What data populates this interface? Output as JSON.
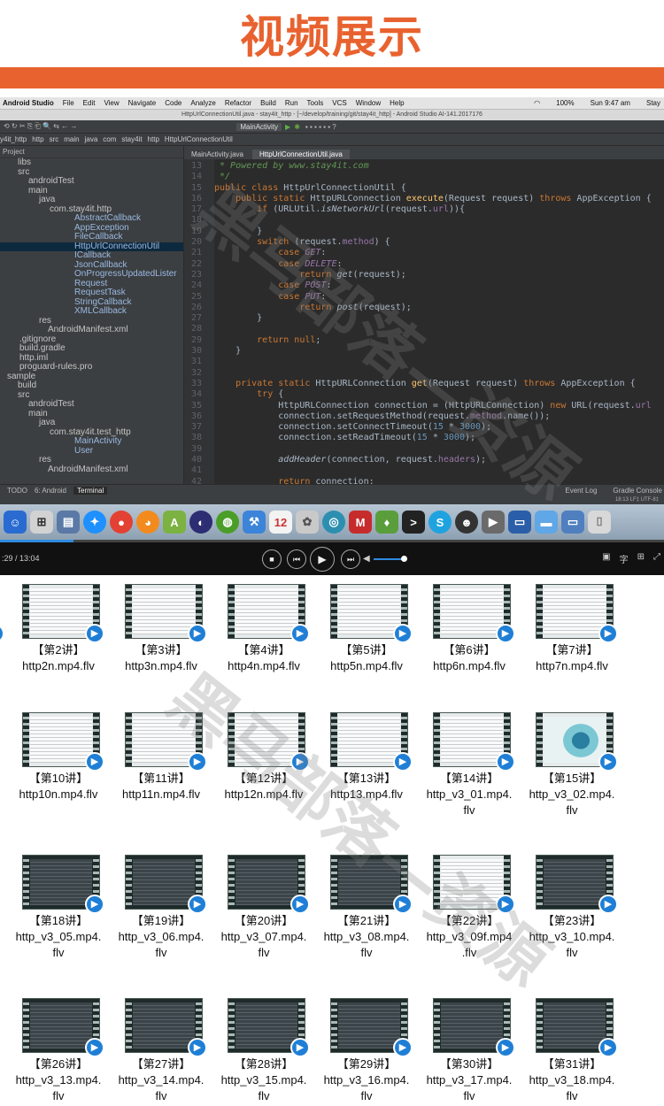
{
  "banner": {
    "title": "视频展示"
  },
  "menubar": {
    "app": "Android Studio",
    "items": [
      "File",
      "Edit",
      "View",
      "Navigate",
      "Code",
      "Analyze",
      "Refactor",
      "Build",
      "Run",
      "Tools",
      "VCS",
      "Window",
      "Help"
    ],
    "battery": "100%",
    "clock": "Sun 9:47 am",
    "user": "Stay"
  },
  "window": {
    "title": "HttpUrlConnectionUtil.java - stay4it_http - [~/develop/training/git/stay4it_http] - Android Studio AI-141.2017176"
  },
  "toolbar": {
    "run_config": "MainActivity"
  },
  "breadcrumbs": [
    "y4it_http",
    "http",
    "src",
    "main",
    "java",
    "com",
    "stay4it",
    "http",
    "HttpUrlConnectionUtil"
  ],
  "project": {
    "header": "Project",
    "tree": [
      "libs",
      "src",
      "androidTest",
      "main",
      "java",
      "com.stay4it.http",
      "AbstractCallback",
      "AppException",
      "FileCallback",
      "HttpUrlConnectionUtil",
      "ICallback",
      "JsonCallback",
      "OnProgressUpdatedLister",
      "Request",
      "RequestTask",
      "StringCallback",
      "XMLCallback",
      "res",
      "AndroidManifest.xml",
      ".gitignore",
      "build.gradle",
      "http.iml",
      "proguard-rules.pro",
      "sample",
      "build",
      "src",
      "androidTest",
      "main",
      "java",
      "com.stay4it.test_http",
      "MainActivity",
      "User",
      "res",
      "AndroidManifest.xml"
    ]
  },
  "editor": {
    "tabs": [
      "MainActivity.java",
      "HttpUrlConnectionUtil.java"
    ],
    "line_numbers": [
      "13",
      "14",
      "15",
      "16",
      "17",
      "18",
      "19",
      "20",
      "21",
      "22",
      "23",
      "24",
      "25",
      "26",
      "27",
      "28",
      "29",
      "30",
      "31",
      "32",
      "33",
      "34",
      "35",
      "36",
      "37",
      "38",
      "39",
      "40",
      "41",
      "42"
    ],
    "code": {
      "l13": " * Powered by www.stay4it.com",
      "l14": " */",
      "l15a": "public class",
      "l15b": " HttpUrlConnectionUtil {",
      "l16a": "    public static",
      "l16b": " HttpURLConnection ",
      "l16c": "execute",
      "l16d": "(Request request) ",
      "l16e": "throws",
      "l16f": " AppException {",
      "l17a": "        if",
      "l17b": " (URLUtil.",
      "l17c": "isNetworkUrl",
      "l17d": "(request.",
      "l17e": "url",
      "l17f": ")){",
      "l19": "        }",
      "l20a": "        switch",
      "l20b": " (request.",
      "l20c": "method",
      "l20d": ") {",
      "l21a": "            case",
      "l21b": " GET",
      "l21c": ":",
      "l22a": "            case",
      "l22b": " DELETE",
      "l22c": ":",
      "l23a": "                return",
      "l23b": " get",
      "l23c": "(request);",
      "l24a": "            case",
      "l24b": " POST",
      "l24c": ":",
      "l25a": "            case",
      "l25b": " PUT",
      "l25c": ":",
      "l26a": "                return",
      "l26b": " post",
      "l26c": "(request);",
      "l27": "        }",
      "l29a": "        return null",
      "l29b": ";",
      "l30": "    }",
      "l33a": "    private static",
      "l33b": " HttpURLConnection ",
      "l33c": "get",
      "l33d": "(Request request) ",
      "l33e": "throws",
      "l33f": " AppException {",
      "l34a": "        try",
      "l34b": " {",
      "l35a": "            HttpURLConnection connection = (HttpURLConnection) ",
      "l35b": "new",
      "l35c": " URL(request.",
      "l35d": "url",
      "l36a": "            connection.setRequestMethod(request.",
      "l36b": "method",
      "l36c": ".name());",
      "l37a": "            connection.setConnectTimeout(",
      "l37b": "15",
      "l37c": " * ",
      "l37d": "3000",
      "l37e": ");",
      "l38a": "            connection.setReadTimeout(",
      "l38b": "15",
      "l38c": " * ",
      "l38d": "3000",
      "l38e": ");",
      "l40a": "            addHeader",
      "l40b": "(connection, request.",
      "l40c": "headers",
      "l40d": ");",
      "l42a": "            return",
      "l42b": " connection;"
    }
  },
  "statusbar": {
    "todo": "TODO",
    "android": "6: Android",
    "terminal": "Terminal",
    "event_log": "Event Log",
    "gradle": "Gradle Console",
    "position": "18:13   LF‡   UTF-8‡"
  },
  "player": {
    "time": ":29 / 13:04",
    "progress_fraction": 0.11,
    "volume_fraction": 0.75,
    "right_controls": [
      "▣",
      "字",
      "⊞",
      "⤢"
    ]
  },
  "grid": {
    "rows": [
      [
        {
          "title": "【第2讲】",
          "file": "http2n.mp4.flv"
        },
        {
          "title": "【第3讲】",
          "file": "http3n.mp4.flv"
        },
        {
          "title": "【第4讲】",
          "file": "http4n.mp4.flv"
        },
        {
          "title": "【第5讲】",
          "file": "http5n.mp4.flv"
        },
        {
          "title": "【第6讲】",
          "file": "http6n.mp4.flv"
        },
        {
          "title": "【第7讲】",
          "file": "http7n.mp4.flv"
        }
      ],
      [
        {
          "title": "【第10讲】",
          "file": "http10n.mp4.flv"
        },
        {
          "title": "【第11讲】",
          "file": "http11n.mp4.flv"
        },
        {
          "title": "【第12讲】",
          "file": "http12n.mp4.flv"
        },
        {
          "title": "【第13讲】",
          "file": "http13.mp4.flv"
        },
        {
          "title": "【第14讲】",
          "file": "http_v3_01.mp4.",
          "file2": "flv"
        },
        {
          "title": "【第15讲】",
          "file": "http_v3_02.mp4.",
          "file2": "flv"
        }
      ],
      [
        {
          "title": "【第18讲】",
          "file": "http_v3_05.mp4.",
          "file2": "flv"
        },
        {
          "title": "【第19讲】",
          "file": "http_v3_06.mp4.",
          "file2": "flv"
        },
        {
          "title": "【第20讲】",
          "file": "http_v3_07.mp4.",
          "file2": "flv"
        },
        {
          "title": "【第21讲】",
          "file": "http_v3_08.mp4.",
          "file2": "flv"
        },
        {
          "title": "【第22讲】",
          "file": "http_v3_09f.mp4",
          "file2": ".flv"
        },
        {
          "title": "【第23讲】",
          "file": "http_v3_10.mp4.",
          "file2": "flv"
        }
      ],
      [
        {
          "title": "【第26讲】",
          "file": "http_v3_13.mp4.",
          "file2": "flv"
        },
        {
          "title": "【第27讲】",
          "file": "http_v3_14.mp4.",
          "file2": "flv"
        },
        {
          "title": "【第28讲】",
          "file": "http_v3_15.mp4.",
          "file2": "flv"
        },
        {
          "title": "【第29讲】",
          "file": "http_v3_16.mp4.",
          "file2": "flv"
        },
        {
          "title": "【第30讲】",
          "file": "http_v3_17.mp4.",
          "file2": "flv"
        },
        {
          "title": "【第31讲】",
          "file": "http_v3_18.mp4.",
          "file2": "flv"
        }
      ]
    ]
  },
  "watermark": {
    "text": "黑马部落—资源"
  },
  "colors": {
    "accent": "#e8622f",
    "player_blue": "#2f8ae0",
    "ide_bg": "#2b2b2b"
  }
}
